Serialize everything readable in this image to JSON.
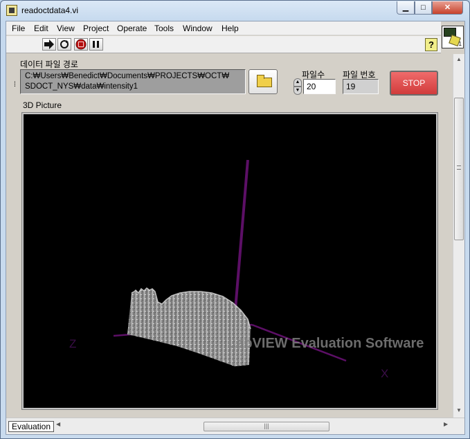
{
  "window": {
    "title": "readoctdata4.vi"
  },
  "title_buttons": {
    "minimize": "▁",
    "maximize": "□",
    "close": "✕"
  },
  "menu": [
    "File",
    "Edit",
    "View",
    "Project",
    "Operate",
    "Tools",
    "Window",
    "Help"
  ],
  "toolbar": {
    "help": "?"
  },
  "vi_icon": {
    "number": "1"
  },
  "path_control": {
    "label": "데이터 파일 경로",
    "line1": "C:₩Users₩Benedict₩Documents₩PROJECTS₩OCT₩",
    "line2": "SDOCT_NYS₩data₩intensity1"
  },
  "file_count": {
    "label": "파일수",
    "value": "20"
  },
  "file_index": {
    "label": "파일 번호",
    "value": "19"
  },
  "stop_button": {
    "label": "STOP",
    "color": "#e04a4a"
  },
  "picture": {
    "label": "3D Picture",
    "axis_labels": {
      "z": "Z",
      "x": "X"
    },
    "axis_color": "#5c0f66",
    "watermark": "LabVIEW  Evaluation Software"
  },
  "statusbar": {
    "tag": "Evaluation"
  }
}
